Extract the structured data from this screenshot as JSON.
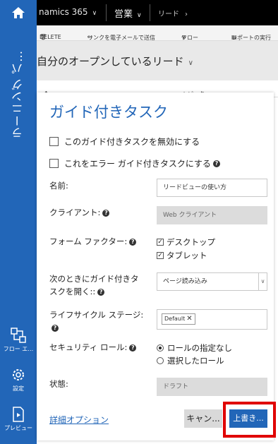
{
  "topbar": {
    "app": "namics 365",
    "area": "営業",
    "entity": "リード"
  },
  "commandbar": {
    "delete": "DELETE",
    "email_link": "リンクを電子メールで送信",
    "flow": "フロー",
    "report": "レポートの実行"
  },
  "view": {
    "title": "自分のオープンしているリード",
    "col_name": "名前",
    "col_topic": "トピック"
  },
  "sidebar": {
    "title": "ラーニング パ…",
    "flow_label": "フロー エ…",
    "settings_label": "設定",
    "preview_label": "プレビュー"
  },
  "dialog": {
    "title": "ガイド付きタスク",
    "disable_label": "このガイド付きタスクを無効にする",
    "error_label": "これをエラー ガイド付きタスクにする",
    "name_label": "名前:",
    "name_value": "リードビューの使い方",
    "client_label": "クライアント:",
    "client_value": "Web クライアント",
    "form_factor_label": "フォーム ファクター:",
    "form_factor_desktop": "デスクトップ",
    "form_factor_tablet": "タブレット",
    "open_label_1": "次のときにガイド付きタ",
    "open_label_2": "スクを開く::",
    "open_value": "ページ読み込み",
    "lifecycle_label": "ライフサイクル ステージ:",
    "lifecycle_tag": "Default",
    "security_label": "セキュリティ ロール:",
    "security_opt1": "ロールの指定なし",
    "security_opt2": "選択したロール",
    "status_label": "状態:",
    "status_value": "ドラフト",
    "advanced_link": "詳細オプション",
    "cancel_button": "キャン...",
    "save_button": "上書き..."
  },
  "colors": {
    "brand_blue": "#2266b8",
    "highlight": "#e00000",
    "readonly": "#dcdcdc"
  }
}
